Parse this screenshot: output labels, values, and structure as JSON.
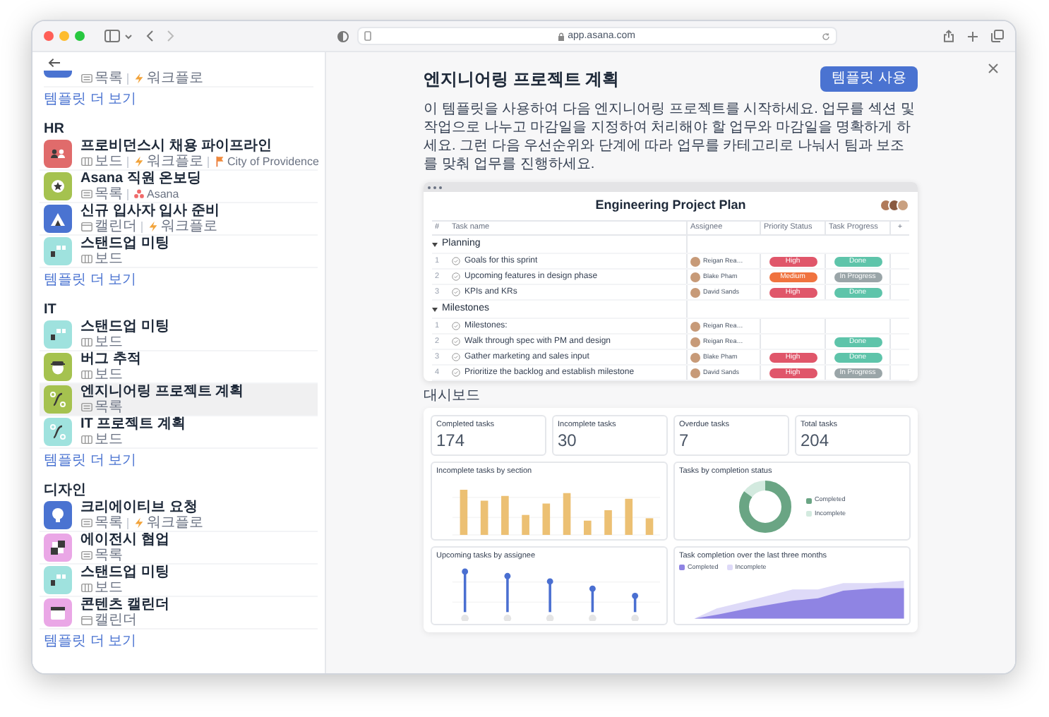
{
  "browser": {
    "url": "app.asana.com"
  },
  "sidebar": {
    "partial_item": {
      "color": "#4a73d1",
      "meta": [
        {
          "kind": "list",
          "label": "목록"
        },
        {
          "kind": "workflow",
          "label": "워크플로"
        }
      ]
    },
    "partial_more_link": "템플릿 더 보기",
    "sections": [
      {
        "title": "HR",
        "more_link": "템플릿 더 보기",
        "items": [
          {
            "kind": "people",
            "color": "#e06b6b",
            "title": "프로비던스시 채용 파이프라인",
            "selected": false,
            "meta": [
              {
                "kind": "board",
                "label": "보드"
              },
              {
                "kind": "workflow",
                "label": "워크플로"
              },
              {
                "kind": "flag",
                "label": "City of Providence"
              }
            ]
          },
          {
            "kind": "star",
            "color": "#a5c24f",
            "title": "Asana 직원 온보딩",
            "selected": false,
            "meta": [
              {
                "kind": "list",
                "label": "목록"
              },
              {
                "kind": "asana",
                "label": "Asana"
              }
            ]
          },
          {
            "kind": "mountain",
            "color": "#4a73d1",
            "title": "신규 입사자 입사 준비",
            "selected": false,
            "meta": [
              {
                "kind": "calendar",
                "label": "캘린더"
              },
              {
                "kind": "workflow",
                "label": "워크플로"
              }
            ]
          },
          {
            "kind": "standup",
            "color": "#9fe2de",
            "title": "스탠드업 미팅",
            "selected": false,
            "meta": [
              {
                "kind": "board",
                "label": "보드"
              }
            ]
          }
        ]
      },
      {
        "title": "IT",
        "more_link": "템플릿 더 보기",
        "items": [
          {
            "kind": "standup",
            "color": "#9fe2de",
            "title": "스탠드업 미팅",
            "selected": false,
            "meta": [
              {
                "kind": "board",
                "label": "보드"
              }
            ]
          },
          {
            "kind": "bug",
            "color": "#a5c24f",
            "title": "버그 추적",
            "selected": false,
            "meta": [
              {
                "kind": "board",
                "label": "보드"
              }
            ]
          },
          {
            "kind": "route",
            "color": "#a5c24f",
            "title": "엔지니어링 프로젝트 계획",
            "selected": true,
            "meta": [
              {
                "kind": "list",
                "label": "목록"
              }
            ]
          },
          {
            "kind": "route",
            "color": "#9fe2de",
            "title": "IT 프로젝트 계획",
            "selected": false,
            "meta": [
              {
                "kind": "board",
                "label": "보드"
              }
            ]
          }
        ]
      },
      {
        "title": "디자인",
        "more_link": "템플릿 더 보기",
        "items": [
          {
            "kind": "bulb",
            "color": "#4a73d1",
            "title": "크리에이티브 요청",
            "selected": false,
            "meta": [
              {
                "kind": "list",
                "label": "목록"
              },
              {
                "kind": "workflow",
                "label": "워크플로"
              }
            ]
          },
          {
            "kind": "blocks",
            "color": "#eaa7e6",
            "title": "에이전시 협업",
            "selected": false,
            "meta": [
              {
                "kind": "list",
                "label": "목록"
              }
            ]
          },
          {
            "kind": "standup",
            "color": "#9fe2de",
            "title": "스탠드업 미팅",
            "selected": false,
            "meta": [
              {
                "kind": "board",
                "label": "보드"
              }
            ]
          },
          {
            "kind": "calendar",
            "color": "#eaa7e6",
            "title": "콘텐츠 캘린더",
            "selected": false,
            "meta": [
              {
                "kind": "calendar",
                "label": "캘린더"
              }
            ]
          }
        ]
      }
    ]
  },
  "template": {
    "title": "엔지니어링 프로젝트 계획",
    "use_button": "템플릿 사용",
    "description": "이 템플릿을 사용하여 다음 엔지니어링 프로젝트를 시작하세요. 업무를 섹션 및 작업으로 나누고 마감일을 지정하여 처리해야 할 업무와 마감일을 명확하게 하세요. 그런 다음 우선순위와 단계에 따라 업무를 카테고리로 나눠서 팀과 보조를 맞춰 업무를 진행하세요."
  },
  "preview": {
    "title": "Engineering Project Plan",
    "columns": [
      "#",
      "Task name",
      "Assignee",
      "Priority Status",
      "Task Progress",
      "+"
    ],
    "sections": [
      {
        "name": "Planning",
        "tasks": [
          {
            "number": "1",
            "name": "Goals for this sprint",
            "assignee": "Reigan Rea…",
            "priority": {
              "label": "High",
              "color": "#e0566a"
            },
            "progress": {
              "label": "Done",
              "color": "#5ec4aa"
            }
          },
          {
            "number": "2",
            "name": "Upcoming features in design phase",
            "assignee": "Blake Pham",
            "priority": {
              "label": "Medium",
              "color": "#f0733f"
            },
            "progress": {
              "label": "In Progress",
              "color": "#9aa5a8"
            }
          },
          {
            "number": "3",
            "name": "KPIs and KRs",
            "assignee": "David Sands",
            "priority": {
              "label": "High",
              "color": "#e0566a"
            },
            "progress": {
              "label": "Done",
              "color": "#5ec4aa"
            }
          }
        ]
      },
      {
        "name": "Milestones",
        "tasks": [
          {
            "number": "1",
            "name": "Milestones:",
            "assignee": "Reigan Rea…"
          },
          {
            "number": "2",
            "name": "Walk through spec with PM and design",
            "assignee": "Reigan Rea…",
            "progress": {
              "label": "Done",
              "color": "#5ec4aa"
            }
          },
          {
            "number": "3",
            "name": "Gather marketing and sales input",
            "assignee": "Blake Pham",
            "priority": {
              "label": "High",
              "color": "#e0566a"
            },
            "progress": {
              "label": "Done",
              "color": "#5ec4aa"
            }
          },
          {
            "number": "4",
            "name": "Prioritize the backlog and establish milestone",
            "assignee": "David Sands",
            "priority": {
              "label": "High",
              "color": "#e0566a"
            },
            "progress": {
              "label": "In Progress",
              "color": "#9aa5a8"
            }
          }
        ]
      }
    ]
  },
  "dashboard": {
    "label": "대시보드",
    "stats": [
      {
        "label": "Completed tasks",
        "value": "174"
      },
      {
        "label": "Incomplete tasks",
        "value": "30"
      },
      {
        "label": "Overdue tasks",
        "value": "7"
      },
      {
        "label": "Total tasks",
        "value": "204"
      }
    ],
    "charts": [
      {
        "kind": "bar",
        "title": "Incomplete tasks by section"
      },
      {
        "kind": "donut",
        "title": "Tasks by completion status",
        "legend": [
          {
            "label": "Completed",
            "color": "#6aa584"
          },
          {
            "label": "Incomplete",
            "color": "#d3eadf"
          }
        ]
      },
      {
        "kind": "lollipop",
        "title": "Upcoming tasks by assignee"
      },
      {
        "kind": "area",
        "title": "Task completion over the last three months",
        "legend": [
          {
            "label": "Completed",
            "color": "#8f84e3"
          },
          {
            "label": "Incomplete",
            "color": "#dedaf8"
          }
        ]
      }
    ]
  }
}
